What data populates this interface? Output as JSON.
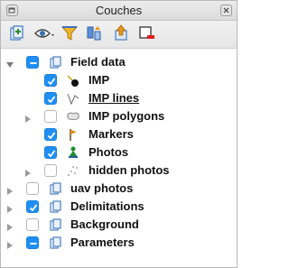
{
  "window": {
    "title": "Couches"
  },
  "toolbar": {
    "icons": [
      "add-layer-icon",
      "visibility-icon",
      "filter-icon",
      "sort-icon",
      "move-up-icon",
      "remove-layer-icon"
    ]
  },
  "layers": [
    {
      "label": "Field data",
      "state": "partial",
      "expanded": true,
      "level": 0,
      "icon": "group-icon"
    },
    {
      "label": "IMP",
      "state": "checked",
      "expanded": false,
      "level": 1,
      "icon": "point-layer-icon",
      "has_arrow": false
    },
    {
      "label": "IMP lines",
      "state": "checked",
      "expanded": false,
      "level": 1,
      "icon": "line-layer-icon",
      "has_arrow": false,
      "underlined": true
    },
    {
      "label": "IMP polygons",
      "state": "unchecked",
      "expanded": false,
      "level": 1,
      "icon": "polygon-layer-icon",
      "has_arrow": true
    },
    {
      "label": "Markers",
      "state": "checked",
      "expanded": false,
      "level": 1,
      "icon": "flag-marker-icon",
      "has_arrow": false
    },
    {
      "label": "Photos",
      "state": "checked",
      "expanded": false,
      "level": 1,
      "icon": "photo-layer-icon",
      "has_arrow": false
    },
    {
      "label": "hidden photos",
      "state": "unchecked",
      "expanded": false,
      "level": 1,
      "icon": "scatter-points-icon",
      "has_arrow": true
    },
    {
      "label": "uav photos",
      "state": "unchecked",
      "expanded": false,
      "level": 0,
      "icon": "group-icon"
    },
    {
      "label": "Delimitations",
      "state": "checked",
      "expanded": false,
      "level": 0,
      "icon": "group-icon"
    },
    {
      "label": "Background",
      "state": "unchecked",
      "expanded": false,
      "level": 0,
      "icon": "group-icon"
    },
    {
      "label": "Parameters",
      "state": "partial",
      "expanded": false,
      "level": 0,
      "icon": "group-icon"
    }
  ],
  "colors": {
    "accent": "#1f8ff6",
    "titlebar": "#e3e3e3"
  }
}
